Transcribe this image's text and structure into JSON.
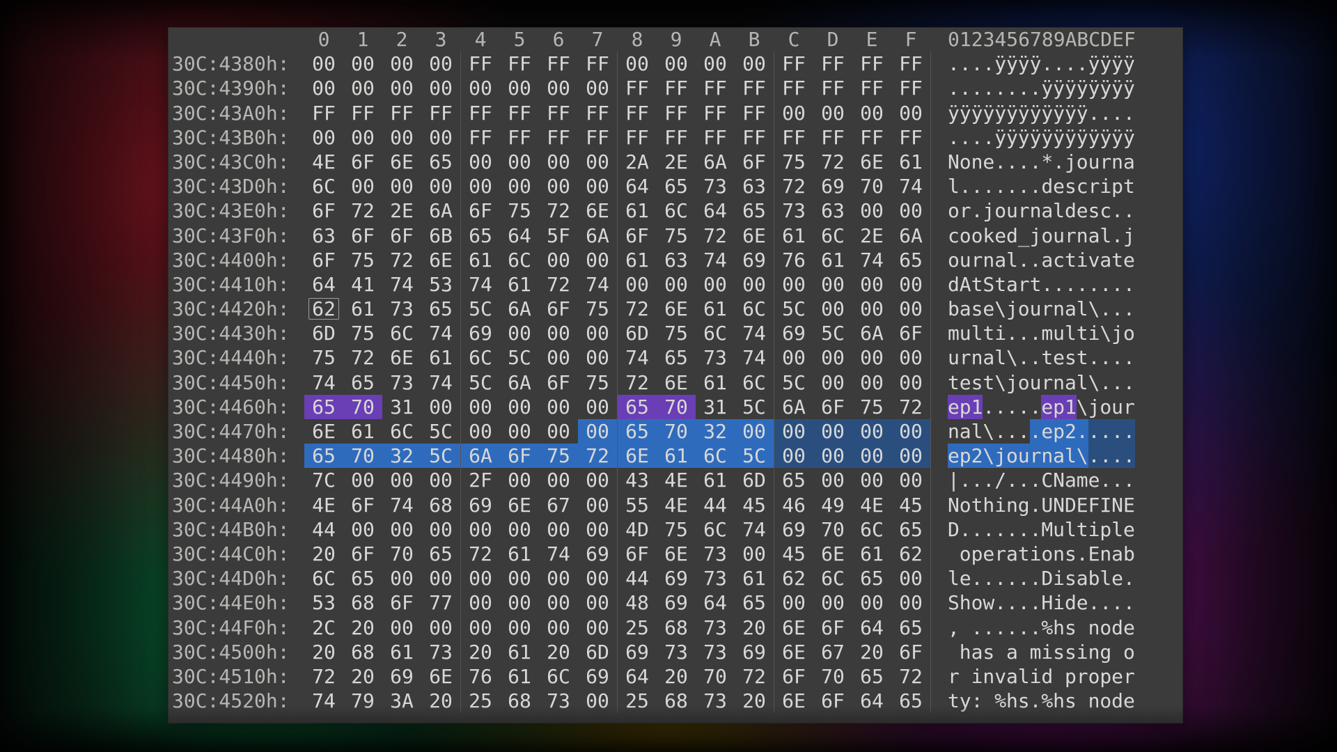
{
  "hex_header": [
    "0",
    "1",
    "2",
    "3",
    "4",
    "5",
    "6",
    "7",
    "8",
    "9",
    "A",
    "B",
    "C",
    "D",
    "E",
    "F"
  ],
  "ascii_header": "0123456789ABCDEF",
  "cursor": {
    "row": 11,
    "col": 0
  },
  "highlights": [
    {
      "row": 17,
      "from": 0,
      "to": 2,
      "class": "hl-pur"
    },
    {
      "row": 17,
      "from": 8,
      "to": 10,
      "class": "hl-pur"
    },
    {
      "row": 18,
      "from": 7,
      "to": 12,
      "class": "hl-blu"
    },
    {
      "row": 18,
      "from": 12,
      "to": 16,
      "class": "hl-blu2"
    },
    {
      "row": 19,
      "from": 0,
      "to": 12,
      "class": "hl-blu"
    },
    {
      "row": 19,
      "from": 12,
      "to": 16,
      "class": "hl-blu2"
    }
  ],
  "ascii_highlights": [
    {
      "row": 17,
      "from": 0,
      "to": 3,
      "class": "hl-pur"
    },
    {
      "row": 17,
      "from": 8,
      "to": 11,
      "class": "hl-pur"
    },
    {
      "row": 18,
      "from": 7,
      "to": 12,
      "class": "hl-blu"
    },
    {
      "row": 18,
      "from": 12,
      "to": 16,
      "class": "hl-blu2"
    },
    {
      "row": 19,
      "from": 0,
      "to": 12,
      "class": "hl-blu"
    },
    {
      "row": 19,
      "from": 12,
      "to": 16,
      "class": "hl-blu2"
    }
  ],
  "rows": [
    {
      "addr": "30C:4380h:",
      "hex": [
        "00",
        "00",
        "00",
        "00",
        "FF",
        "FF",
        "FF",
        "FF",
        "00",
        "00",
        "00",
        "00",
        "FF",
        "FF",
        "FF",
        "FF"
      ],
      "ascii": "....ÿÿÿÿ....ÿÿÿÿ"
    },
    {
      "addr": "30C:4390h:",
      "hex": [
        "00",
        "00",
        "00",
        "00",
        "00",
        "00",
        "00",
        "00",
        "FF",
        "FF",
        "FF",
        "FF",
        "FF",
        "FF",
        "FF",
        "FF"
      ],
      "ascii": "........ÿÿÿÿÿÿÿÿ"
    },
    {
      "addr": "30C:43A0h:",
      "hex": [
        "FF",
        "FF",
        "FF",
        "FF",
        "FF",
        "FF",
        "FF",
        "FF",
        "FF",
        "FF",
        "FF",
        "FF",
        "00",
        "00",
        "00",
        "00"
      ],
      "ascii": "ÿÿÿÿÿÿÿÿÿÿÿÿ...."
    },
    {
      "addr": "30C:43B0h:",
      "hex": [
        "00",
        "00",
        "00",
        "00",
        "FF",
        "FF",
        "FF",
        "FF",
        "FF",
        "FF",
        "FF",
        "FF",
        "FF",
        "FF",
        "FF",
        "FF"
      ],
      "ascii": "....ÿÿÿÿÿÿÿÿÿÿÿÿ"
    },
    {
      "addr": "30C:43C0h:",
      "hex": [
        "4E",
        "6F",
        "6E",
        "65",
        "00",
        "00",
        "00",
        "00",
        "2A",
        "2E",
        "6A",
        "6F",
        "75",
        "72",
        "6E",
        "61"
      ],
      "ascii": "None....*.journa"
    },
    {
      "addr": "30C:43D0h:",
      "hex": [
        "6C",
        "00",
        "00",
        "00",
        "00",
        "00",
        "00",
        "00",
        "64",
        "65",
        "73",
        "63",
        "72",
        "69",
        "70",
        "74"
      ],
      "ascii": "l.......descript"
    },
    {
      "addr": "30C:43E0h:",
      "hex": [
        "6F",
        "72",
        "2E",
        "6A",
        "6F",
        "75",
        "72",
        "6E",
        "61",
        "6C",
        "64",
        "65",
        "73",
        "63",
        "00",
        "00"
      ],
      "ascii": "or.journaldesc.."
    },
    {
      "addr": "30C:43F0h:",
      "hex": [
        "63",
        "6F",
        "6F",
        "6B",
        "65",
        "64",
        "5F",
        "6A",
        "6F",
        "75",
        "72",
        "6E",
        "61",
        "6C",
        "2E",
        "6A"
      ],
      "ascii": "cooked_journal.j"
    },
    {
      "addr": "30C:4400h:",
      "hex": [
        "6F",
        "75",
        "72",
        "6E",
        "61",
        "6C",
        "00",
        "00",
        "61",
        "63",
        "74",
        "69",
        "76",
        "61",
        "74",
        "65"
      ],
      "ascii": "ournal..activate"
    },
    {
      "addr": "30C:4410h:",
      "hex": [
        "64",
        "41",
        "74",
        "53",
        "74",
        "61",
        "72",
        "74",
        "00",
        "00",
        "00",
        "00",
        "00",
        "00",
        "00",
        "00"
      ],
      "ascii": "dAtStart........"
    },
    {
      "addr": "30C:4420h:",
      "hex": [
        "62",
        "61",
        "73",
        "65",
        "5C",
        "6A",
        "6F",
        "75",
        "72",
        "6E",
        "61",
        "6C",
        "5C",
        "00",
        "00",
        "00"
      ],
      "ascii": "base\\journal\\..."
    },
    {
      "addr": "30C:4430h:",
      "hex": [
        "6D",
        "75",
        "6C",
        "74",
        "69",
        "00",
        "00",
        "00",
        "6D",
        "75",
        "6C",
        "74",
        "69",
        "5C",
        "6A",
        "6F"
      ],
      "ascii": "multi...multi\\jo"
    },
    {
      "addr": "30C:4440h:",
      "hex": [
        "75",
        "72",
        "6E",
        "61",
        "6C",
        "5C",
        "00",
        "00",
        "74",
        "65",
        "73",
        "74",
        "00",
        "00",
        "00",
        "00"
      ],
      "ascii": "urnal\\..test...."
    },
    {
      "addr": "30C:4450h:",
      "hex": [
        "74",
        "65",
        "73",
        "74",
        "5C",
        "6A",
        "6F",
        "75",
        "72",
        "6E",
        "61",
        "6C",
        "5C",
        "00",
        "00",
        "00"
      ],
      "ascii": "test\\journal\\..."
    },
    {
      "addr": "30C:4460h:",
      "hex": [
        "65",
        "70",
        "31",
        "00",
        "00",
        "00",
        "00",
        "00",
        "65",
        "70",
        "31",
        "5C",
        "6A",
        "6F",
        "75",
        "72"
      ],
      "ascii": "ep1.....ep1\\jour"
    },
    {
      "addr": "30C:4470h:",
      "hex": [
        "6E",
        "61",
        "6C",
        "5C",
        "00",
        "00",
        "00",
        "00",
        "65",
        "70",
        "32",
        "00",
        "00",
        "00",
        "00",
        "00"
      ],
      "ascii": "nal\\....ep2....."
    },
    {
      "addr": "30C:4480h:",
      "hex": [
        "65",
        "70",
        "32",
        "5C",
        "6A",
        "6F",
        "75",
        "72",
        "6E",
        "61",
        "6C",
        "5C",
        "00",
        "00",
        "00",
        "00"
      ],
      "ascii": "ep2\\journal\\...."
    },
    {
      "addr": "30C:4490h:",
      "hex": [
        "7C",
        "00",
        "00",
        "00",
        "2F",
        "00",
        "00",
        "00",
        "43",
        "4E",
        "61",
        "6D",
        "65",
        "00",
        "00",
        "00"
      ],
      "ascii": "|.../...CName..."
    },
    {
      "addr": "30C:44A0h:",
      "hex": [
        "4E",
        "6F",
        "74",
        "68",
        "69",
        "6E",
        "67",
        "00",
        "55",
        "4E",
        "44",
        "45",
        "46",
        "49",
        "4E",
        "45"
      ],
      "ascii": "Nothing.UNDEFINE"
    },
    {
      "addr": "30C:44B0h:",
      "hex": [
        "44",
        "00",
        "00",
        "00",
        "00",
        "00",
        "00",
        "00",
        "4D",
        "75",
        "6C",
        "74",
        "69",
        "70",
        "6C",
        "65"
      ],
      "ascii": "D.......Multiple"
    },
    {
      "addr": "30C:44C0h:",
      "hex": [
        "20",
        "6F",
        "70",
        "65",
        "72",
        "61",
        "74",
        "69",
        "6F",
        "6E",
        "73",
        "00",
        "45",
        "6E",
        "61",
        "62"
      ],
      "ascii": " operations.Enab"
    },
    {
      "addr": "30C:44D0h:",
      "hex": [
        "6C",
        "65",
        "00",
        "00",
        "00",
        "00",
        "00",
        "00",
        "44",
        "69",
        "73",
        "61",
        "62",
        "6C",
        "65",
        "00"
      ],
      "ascii": "le......Disable."
    },
    {
      "addr": "30C:44E0h:",
      "hex": [
        "53",
        "68",
        "6F",
        "77",
        "00",
        "00",
        "00",
        "00",
        "48",
        "69",
        "64",
        "65",
        "00",
        "00",
        "00",
        "00"
      ],
      "ascii": "Show....Hide...."
    },
    {
      "addr": "30C:44F0h:",
      "hex": [
        "2C",
        "20",
        "00",
        "00",
        "00",
        "00",
        "00",
        "00",
        "25",
        "68",
        "73",
        "20",
        "6E",
        "6F",
        "64",
        "65"
      ],
      "ascii": ", ......%hs node"
    },
    {
      "addr": "30C:4500h:",
      "hex": [
        "20",
        "68",
        "61",
        "73",
        "20",
        "61",
        "20",
        "6D",
        "69",
        "73",
        "73",
        "69",
        "6E",
        "67",
        "20",
        "6F"
      ],
      "ascii": " has a missing o"
    },
    {
      "addr": "30C:4510h:",
      "hex": [
        "72",
        "20",
        "69",
        "6E",
        "76",
        "61",
        "6C",
        "69",
        "64",
        "20",
        "70",
        "72",
        "6F",
        "70",
        "65",
        "72"
      ],
      "ascii": "r invalid proper"
    },
    {
      "addr": "30C:4520h:",
      "hex": [
        "74",
        "79",
        "3A",
        "20",
        "25",
        "68",
        "73",
        "00",
        "25",
        "68",
        "73",
        "20",
        "6E",
        "6F",
        "64",
        "65"
      ],
      "ascii": "ty: %hs.%hs node"
    }
  ]
}
